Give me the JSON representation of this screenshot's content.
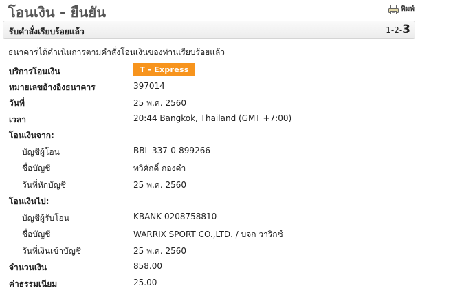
{
  "page": {
    "title": "โอนเงิน - ยืนยัน",
    "print_label": "พิมพ์",
    "print_icon": "printer-icon"
  },
  "steps": {
    "title": "รับคำสั่งเรียบร้อยแล้ว",
    "prefix": "1-2-",
    "current": "3"
  },
  "confirmation_message": "ธนาคารได้ดำเนินการตามคำสั่งโอนเงินของท่านเรียบร้อยแล้ว",
  "service": {
    "label": "บริการโอนเงิน",
    "badge": "T - Express",
    "badge_color": "#f7941d"
  },
  "reference": {
    "label": "หมายเลขอ้างอิงธนาคาร",
    "value": "397014"
  },
  "date": {
    "label": "วันที่",
    "value": "25 พ.ค. 2560"
  },
  "time": {
    "label": "เวลา",
    "value": "20:44 Bangkok, Thailand (GMT +7:00)"
  },
  "from": {
    "header": "โอนเงินจาก:",
    "account_label": "บัญชีผู้โอน",
    "account_value": "BBL 337-0-899266",
    "name_label": "ชื่อบัญชี",
    "name_value": "ทวิศักดิ์ กองคำ",
    "debit_date_label": "วันที่หักบัญชี",
    "debit_date_value": "25 พ.ค. 2560"
  },
  "to": {
    "header": "โอนเงินไป:",
    "account_label": "บัญชีผู้รับโอน",
    "account_value": "KBANK 0208758810",
    "name_label": "ชื่อบัญชี",
    "name_value": "WARRIX SPORT CO.,LTD. / บจก วาริกซ์",
    "credit_date_label": "วันที่เงินเข้าบัญชี",
    "credit_date_value": "25 พ.ค. 2560"
  },
  "amount": {
    "label": "จำนวนเงิน",
    "value": "858.00"
  },
  "fee": {
    "label": "ค่าธรรมเนียม",
    "value": "25.00"
  }
}
